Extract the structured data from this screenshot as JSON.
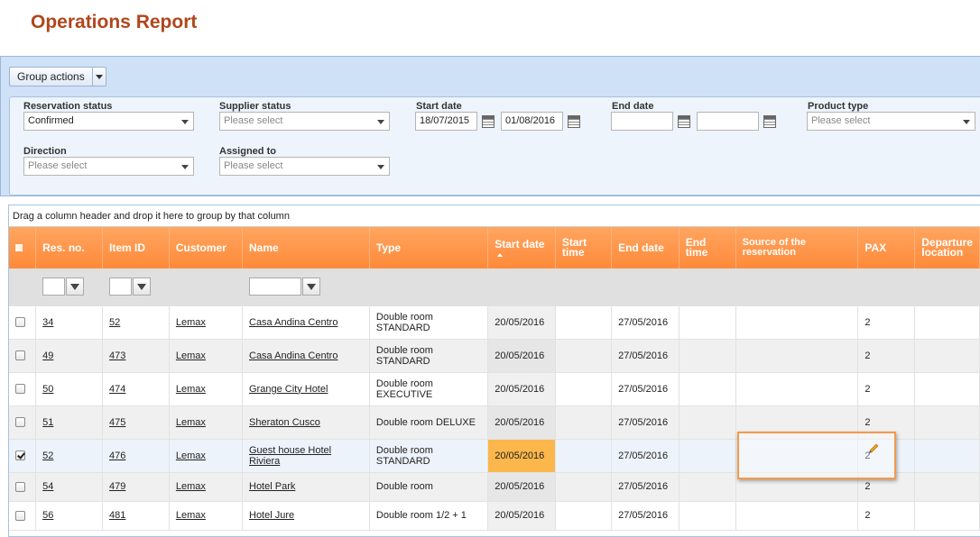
{
  "page": {
    "title": "Operations Report"
  },
  "toolbar": {
    "group_actions_label": "Group actions"
  },
  "filters": {
    "reservation_status": {
      "label": "Reservation status",
      "value": "Confirmed"
    },
    "supplier_status": {
      "label": "Supplier status",
      "placeholder": "Please select"
    },
    "start_date": {
      "label": "Start date",
      "from": "18/07/2015",
      "to": "01/08/2016"
    },
    "end_date": {
      "label": "End date",
      "from": "",
      "to": ""
    },
    "product_type": {
      "label": "Product type",
      "placeholder": "Please select"
    },
    "direction": {
      "label": "Direction",
      "placeholder": "Please select"
    },
    "assigned_to": {
      "label": "Assigned to",
      "placeholder": "Please select"
    }
  },
  "grid": {
    "group_hint": "Drag a column header and drop it here to group by that column",
    "columns": {
      "res_no": "Res. no.",
      "item_id": "Item ID",
      "customer": "Customer",
      "name": "Name",
      "type": "Type",
      "start_date": "Start date",
      "start_time": "Start time",
      "end_date": "End date",
      "end_time": "End time",
      "source": "Source of the reservation",
      "pax": "PAX",
      "departure": "Departure location"
    },
    "rows": [
      {
        "checked": false,
        "res_no": "34",
        "item_id": "52",
        "customer": "Lemax",
        "name": "Casa Andina Centro",
        "type": "Double room STANDARD",
        "start_date": "20/05/2016",
        "start_time": "",
        "end_date": "27/05/2016",
        "end_time": "",
        "source": "",
        "pax": "2",
        "departure": ""
      },
      {
        "checked": false,
        "res_no": "49",
        "item_id": "473",
        "customer": "Lemax",
        "name": "Casa Andina Centro",
        "type": "Double room STANDARD",
        "start_date": "20/05/2016",
        "start_time": "",
        "end_date": "27/05/2016",
        "end_time": "",
        "source": "",
        "pax": "2",
        "departure": ""
      },
      {
        "checked": false,
        "res_no": "50",
        "item_id": "474",
        "customer": "Lemax",
        "name": "Grange City Hotel",
        "type": "Double room EXECUTIVE",
        "start_date": "20/05/2016",
        "start_time": "",
        "end_date": "27/05/2016",
        "end_time": "",
        "source": "",
        "pax": "2",
        "departure": ""
      },
      {
        "checked": false,
        "res_no": "51",
        "item_id": "475",
        "customer": "Lemax",
        "name": "Sheraton Cusco",
        "type": "Double room DELUXE",
        "start_date": "20/05/2016",
        "start_time": "",
        "end_date": "27/05/2016",
        "end_time": "",
        "source": "",
        "pax": "2",
        "departure": ""
      },
      {
        "checked": true,
        "res_no": "52",
        "item_id": "476",
        "customer": "Lemax",
        "name": "Guest house Hotel Riviera",
        "type": "Double room STANDARD",
        "start_date": "20/05/2016",
        "start_time": "",
        "end_date": "27/05/2016",
        "end_time": "",
        "source": "",
        "pax": "2",
        "departure": ""
      },
      {
        "checked": false,
        "res_no": "54",
        "item_id": "479",
        "customer": "Lemax",
        "name": "Hotel Park",
        "type": "Double room",
        "start_date": "20/05/2016",
        "start_time": "",
        "end_date": "27/05/2016",
        "end_time": "",
        "source": "",
        "pax": "2",
        "departure": ""
      },
      {
        "checked": false,
        "res_no": "56",
        "item_id": "481",
        "customer": "Lemax",
        "name": "Hotel Jure",
        "type": "Double room 1/2 + 1",
        "start_date": "20/05/2016",
        "start_time": "",
        "end_date": "27/05/2016",
        "end_time": "",
        "source": "",
        "pax": "2",
        "departure": ""
      }
    ]
  },
  "icons": {
    "edit": "pencil-icon",
    "calendar": "calendar-icon",
    "filter": "filter-icon"
  },
  "colors": {
    "title": "#b0461c",
    "header": "#ff9448",
    "selected_cell": "#fbb74b",
    "edit_border": "#f39a4c"
  }
}
